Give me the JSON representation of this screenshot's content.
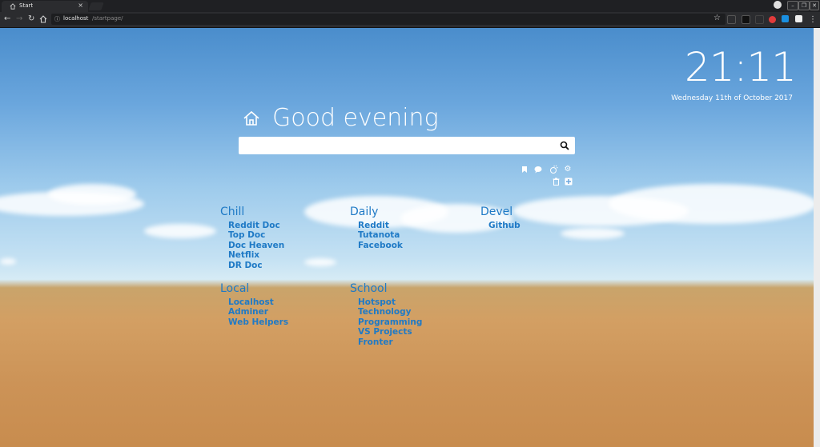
{
  "browser": {
    "tab_title": "Start",
    "tab_close": "×",
    "url_host": "localhost",
    "url_path": "/startpage/"
  },
  "page": {
    "clock": "21:11",
    "date": "Wednesday 11th of October 2017",
    "greeting": "Good evening",
    "search_placeholder": ""
  },
  "groups": [
    {
      "title": "Chill",
      "links": [
        "Reddit Doc",
        "Top Doc",
        "Doc Heaven",
        "Netflix",
        "DR Doc"
      ]
    },
    {
      "title": "Daily",
      "links": [
        "Reddit",
        "Tutanota",
        "Facebook"
      ]
    },
    {
      "title": "Devel",
      "links": [
        "Github"
      ]
    },
    {
      "title": "Local",
      "links": [
        "Localhost",
        "Adminer",
        "Web Helpers"
      ]
    },
    {
      "title": "School",
      "links": [
        "Hotspot",
        "Technology",
        "Programming",
        "VS Projects",
        "Fronter"
      ]
    }
  ],
  "icons": {
    "tab": "home-icon",
    "nav": [
      "back-icon",
      "forward-icon",
      "reload-icon",
      "home-icon"
    ],
    "tools": [
      "bookmark-icon",
      "chat-icon",
      "weather-icon",
      "settings-icon",
      "trash-icon",
      "add-icon"
    ]
  },
  "colors": {
    "link": "#1f7ac6",
    "sky": "#6aa6dd",
    "field": "#cc9357"
  }
}
